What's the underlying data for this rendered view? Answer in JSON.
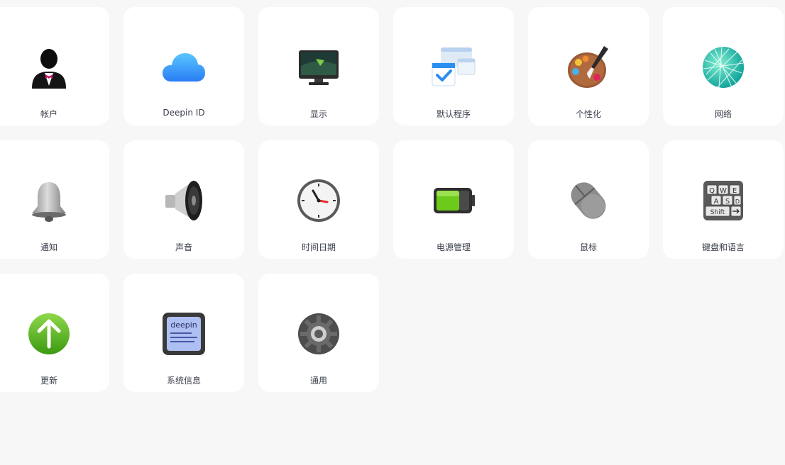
{
  "tiles": [
    {
      "label": "帐户",
      "icon": "account-icon"
    },
    {
      "label": "Deepin ID",
      "icon": "cloud-icon"
    },
    {
      "label": "显示",
      "icon": "display-icon"
    },
    {
      "label": "默认程序",
      "icon": "default-apps-icon"
    },
    {
      "label": "个性化",
      "icon": "palette-icon"
    },
    {
      "label": "网络",
      "icon": "network-globe-icon"
    },
    {
      "label": "通知",
      "icon": "bell-icon"
    },
    {
      "label": "声音",
      "icon": "speaker-icon"
    },
    {
      "label": "时间日期",
      "icon": "clock-icon"
    },
    {
      "label": "电源管理",
      "icon": "battery-icon"
    },
    {
      "label": "鼠标",
      "icon": "mouse-icon"
    },
    {
      "label": "键盘和语言",
      "icon": "keyboard-icon"
    },
    {
      "label": "更新",
      "icon": "update-arrow-icon"
    },
    {
      "label": "系统信息",
      "icon": "system-info-icon"
    },
    {
      "label": "通用",
      "icon": "gear-icon"
    }
  ],
  "icon_texts": {
    "system_info": "deepin",
    "keyboard_keys": [
      "Q",
      "W",
      "E",
      "A",
      "S",
      "D",
      "Shift"
    ]
  }
}
